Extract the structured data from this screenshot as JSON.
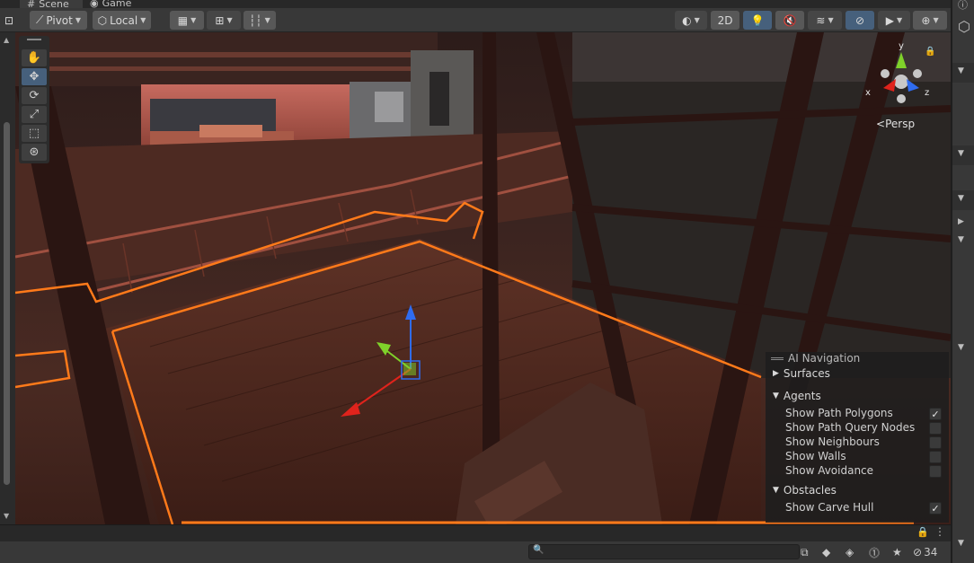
{
  "tabs": [
    {
      "label": "Scene",
      "icon": "hash-grid-icon"
    },
    {
      "label": "Game",
      "icon": "gamepad-icon"
    }
  ],
  "toolbar": {
    "pivot_label": "Pivot",
    "local_label": "Local",
    "mode_2d_label": "2D"
  },
  "scene": {
    "gizmo_axes": {
      "x": "x",
      "y": "y",
      "z": "z"
    },
    "projection_label": "Persp"
  },
  "ai_navigation": {
    "title": "AI Navigation",
    "sections": [
      {
        "label": "Surfaces",
        "expanded": false,
        "options": []
      },
      {
        "label": "Agents",
        "expanded": true,
        "options": [
          {
            "label": "Show Path Polygons",
            "checked": true
          },
          {
            "label": "Show Path Query Nodes",
            "checked": false
          },
          {
            "label": "Show Neighbours",
            "checked": false
          },
          {
            "label": "Show Walls",
            "checked": false
          },
          {
            "label": "Show Avoidance",
            "checked": false
          }
        ]
      },
      {
        "label": "Obstacles",
        "expanded": true,
        "options": [
          {
            "label": "Show Carve Hull",
            "checked": true
          }
        ]
      }
    ],
    "check_glyph": "✓"
  },
  "status": {
    "hidden_count": "34"
  },
  "colors": {
    "accent": "#46607c",
    "navmesh_outline": "#ff7a1a",
    "axis_x": "#e0231c",
    "axis_y": "#7fd12a",
    "axis_z": "#2f6cf0"
  }
}
